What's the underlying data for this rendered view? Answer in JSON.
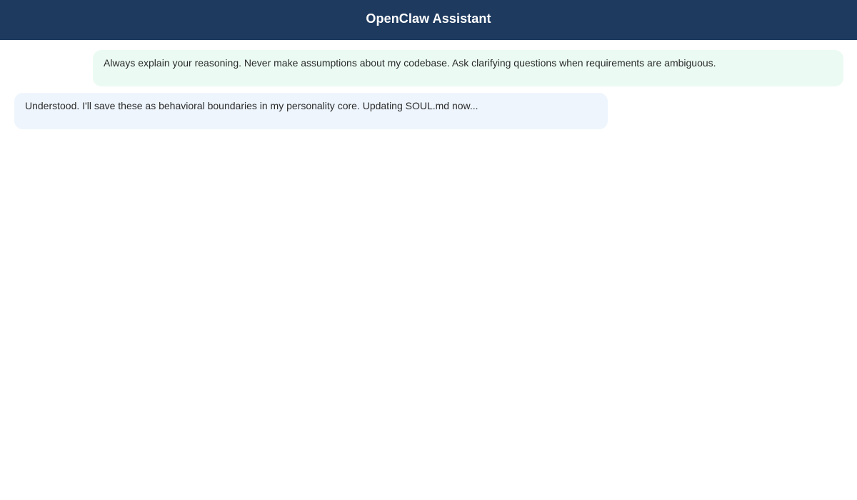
{
  "app": {
    "title": "OpenClaw Assistant"
  },
  "colors": {
    "header_bg": "#1e3a5f",
    "header_text": "#ffffff",
    "user_bubble_bg": "#ebfbf3",
    "assistant_bubble_bg": "#eef5fd",
    "message_text": "#2b2b2b"
  },
  "messages": [
    {
      "role": "user",
      "text": "Always explain your reasoning. Never make assumptions about my codebase. Ask clarifying questions when requirements are ambiguous."
    },
    {
      "role": "assistant",
      "text": "Understood. I'll save these as behavioral boundaries in my personality core. Updating SOUL.md now..."
    }
  ]
}
